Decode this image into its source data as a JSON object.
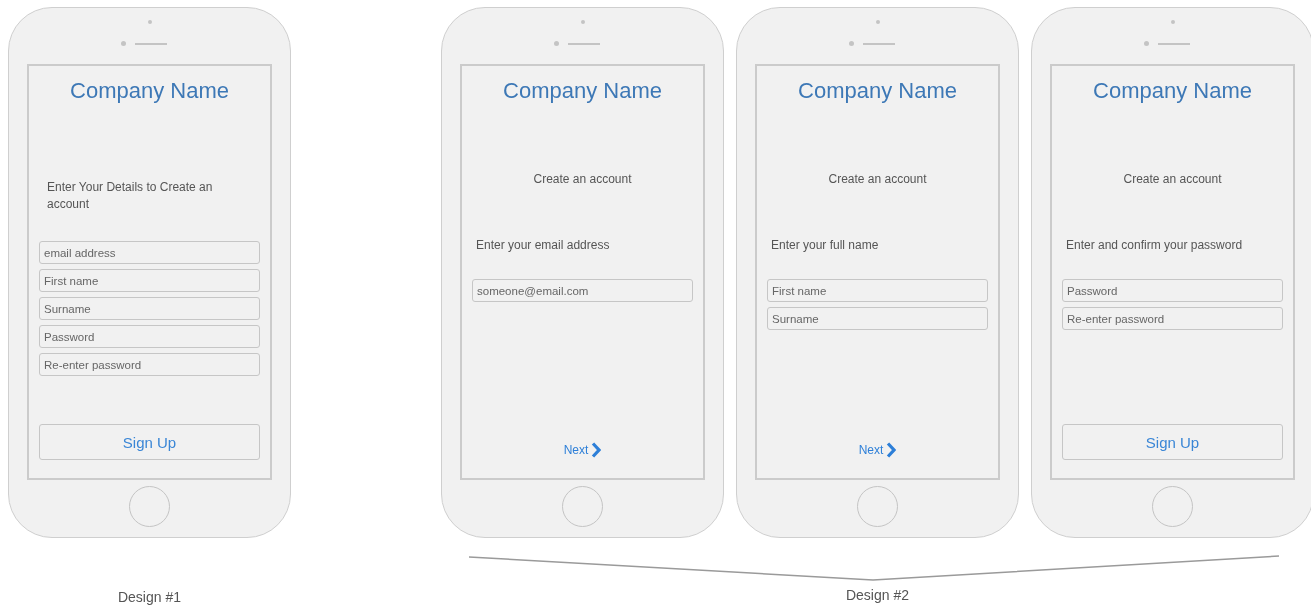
{
  "designs": [
    {
      "caption": "Design #1",
      "phones": [
        {
          "kind": "single",
          "company": "Company Name",
          "intro": "Enter Your Details to Create an account",
          "fields": [
            {
              "placeholder": "email address"
            },
            {
              "placeholder": "First name"
            },
            {
              "placeholder": "Surname"
            },
            {
              "placeholder": "Password"
            },
            {
              "placeholder": "Re-enter password"
            }
          ],
          "action": {
            "kind": "button",
            "label": "Sign Up"
          }
        }
      ]
    },
    {
      "caption": "Design #2",
      "phones": [
        {
          "kind": "step",
          "company": "Company Name",
          "heading": "Create an account",
          "prompt": "Enter your email address",
          "fields": [
            {
              "placeholder": "someone@email.com"
            }
          ],
          "action": {
            "kind": "next",
            "label": "Next"
          }
        },
        {
          "kind": "step",
          "company": "Company Name",
          "heading": "Create an account",
          "prompt": "Enter your full name",
          "fields": [
            {
              "placeholder": "First name"
            },
            {
              "placeholder": "Surname"
            }
          ],
          "action": {
            "kind": "next",
            "label": "Next"
          }
        },
        {
          "kind": "step",
          "company": "Company Name",
          "heading": "Create an account",
          "prompt": "Enter and confirm your password",
          "fields": [
            {
              "placeholder": "Password"
            },
            {
              "placeholder": "Re-enter password"
            }
          ],
          "action": {
            "kind": "button",
            "label": "Sign Up"
          }
        }
      ]
    }
  ]
}
